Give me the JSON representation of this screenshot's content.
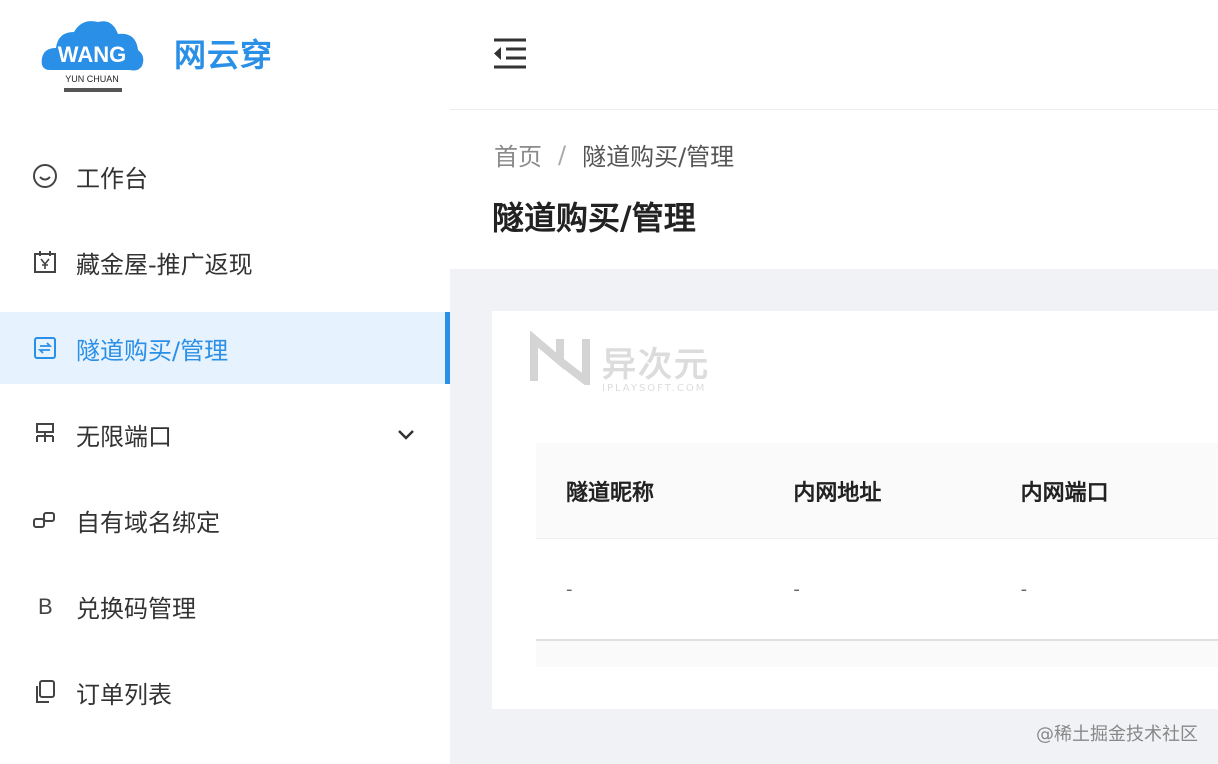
{
  "brand": {
    "logo_text": "WANG",
    "logo_sub": "YUN CHUAN",
    "name": "网云穿"
  },
  "sidebar": {
    "items": [
      {
        "label": "工作台",
        "icon": "smile-icon",
        "active": false
      },
      {
        "label": "藏金屋-推广返现",
        "icon": "yen-calendar-icon",
        "active": false
      },
      {
        "label": "隧道购买/管理",
        "icon": "tunnel-icon",
        "active": true
      },
      {
        "label": "无限端口",
        "icon": "network-icon",
        "active": false,
        "expandable": true
      },
      {
        "label": "自有域名绑定",
        "icon": "link-icon",
        "active": false
      },
      {
        "label": "兑换码管理",
        "icon": "letter-b-icon",
        "active": false
      },
      {
        "label": "订单列表",
        "icon": "copy-icon",
        "active": false
      }
    ]
  },
  "header": {
    "collapse_icon": "menu-fold-icon"
  },
  "breadcrumb": {
    "home": "首页",
    "separator": "/",
    "current": "隧道购买/管理"
  },
  "page": {
    "title": "隧道购买/管理"
  },
  "watermark": {
    "text": "异次元",
    "sub": "IPLAYSOFT.COM"
  },
  "table": {
    "columns": [
      "隧道昵称",
      "内网地址",
      "内网端口"
    ],
    "rows": [
      [
        "-",
        "-",
        "-"
      ]
    ]
  },
  "footer": {
    "credit": "@稀土掘金技术社区"
  },
  "colors": {
    "accent": "#2a8fe6",
    "active_bg": "#e6f2fd",
    "content_bg": "#f0f2f5"
  }
}
